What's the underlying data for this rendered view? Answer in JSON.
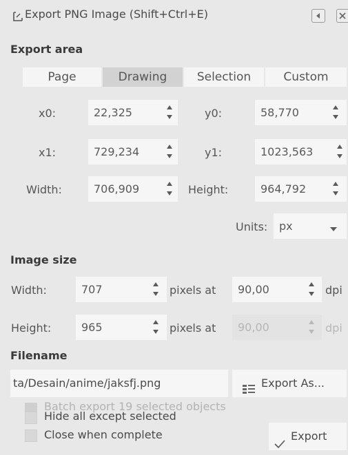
{
  "dialog": {
    "title": "Export PNG Image (Shift+Ctrl+E)"
  },
  "export_area": {
    "heading": "Export area",
    "tabs": [
      "Page",
      "Drawing",
      "Selection",
      "Custom"
    ],
    "active_tab": "Drawing",
    "x0_label": "x0:",
    "x0_value": "22,325",
    "y0_label": "y0:",
    "y0_value": "58,770",
    "x1_label": "x1:",
    "x1_value": "729,234",
    "y1_label": "y1:",
    "y1_value": "1023,563",
    "width_label": "Width:",
    "width_value": "706,909",
    "height_label": "Height:",
    "height_value": "964,792",
    "units_label": "Units:",
    "units_value": "px"
  },
  "image_size": {
    "heading": "Image size",
    "width_label": "Width:",
    "width_value": "707",
    "height_label": "Height:",
    "height_value": "965",
    "pixels_at_label": "pixels at",
    "dpi_value": "90,00",
    "dpi_value_disabled": "90,00",
    "dpi_label": "dpi"
  },
  "filename": {
    "heading": "Filename",
    "value": "ta/Desain/anime/jaksfj.png",
    "export_as_label": "Export As..."
  },
  "options": {
    "batch_export_label": "Batch export 19 selected objects",
    "hide_all_label": "Hide all except selected",
    "close_when_complete_label": "Close when complete"
  },
  "export_button_label": "Export",
  "icons": {
    "dialog": "dialog-corner-icon",
    "export_as": "folder-list-icon",
    "export": "checkmark-icon"
  }
}
